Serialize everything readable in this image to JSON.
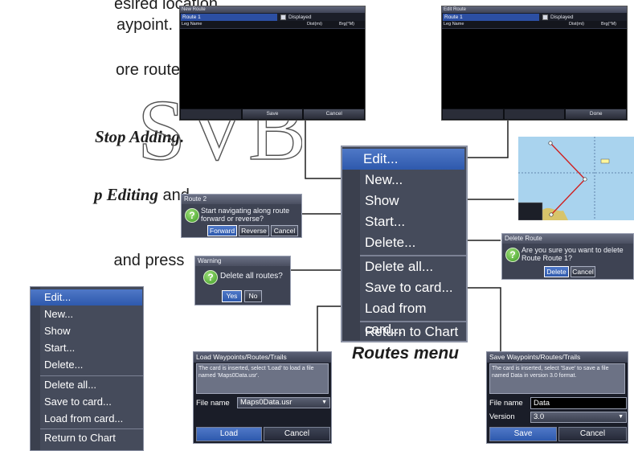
{
  "body_text": {
    "line1": "esired location.",
    "line2": "aypoint.",
    "line3": "ore route",
    "stop_adding": "Stop Adding.",
    "stop_editing": "p Editing",
    "and": " and",
    "and_press": " and press"
  },
  "watermark": "SVB",
  "new_route_screen": {
    "title": "New Route",
    "route_name": "Route 1",
    "displayed_label": "Displayed",
    "col_leg": "Leg Name",
    "col_dist": "Dist(mi)",
    "col_brg": "Brg(°M)",
    "save_label": "Save",
    "cancel_label": "Cancel"
  },
  "edit_route_screen": {
    "title": "Edit Route",
    "route_name": "Route 1",
    "displayed_label": "Displayed",
    "col_leg": "Leg Name",
    "col_dist": "Dist(mi)",
    "col_brg": "Brg(°M)",
    "done_label": "Done"
  },
  "routes_menu": {
    "caption": "Routes menu",
    "items": [
      "Edit...",
      "New...",
      "Show",
      "Start...",
      "Delete...",
      "Delete all...",
      "Save to card...",
      "Load from card...",
      "Return to Chart"
    ]
  },
  "small_menu": {
    "items": [
      "Edit...",
      "New...",
      "Show",
      "Start...",
      "Delete...",
      "Delete all...",
      "Save to card...",
      "Load from card...",
      "Return to Chart"
    ]
  },
  "start_dialog": {
    "title": "Route 2",
    "message": "Start navigating along route forward or reverse?",
    "forward_label": "Forward",
    "reverse_label": "Reverse",
    "cancel_label": "Cancel"
  },
  "warning_dialog": {
    "title": "Warning",
    "message": "Delete all routes?",
    "yes_label": "Yes",
    "no_label": "No"
  },
  "delete_dialog": {
    "title": "Delete Route",
    "message": "Are you sure you want to delete Route Route 1?",
    "delete_label": "Delete",
    "cancel_label": "Cancel"
  },
  "load_panel": {
    "title": "Load Waypoints/Routes/Trails",
    "description": "The card is inserted, select 'Load' to load a file named 'Maps0Data.usr'.",
    "file_label": "File name",
    "file_value": "Maps0Data.usr",
    "load_label": "Load",
    "cancel_label": "Cancel"
  },
  "save_panel": {
    "title": "Save Waypoints/Routes/Trails",
    "description": "The card is inserted, select 'Save' to save a file named Data in version 3.0 format.",
    "file_label": "File name",
    "file_value": "Data",
    "version_label": "Version",
    "version_value": "3.0",
    "save_label": "Save",
    "cancel_label": "Cancel"
  },
  "colors": {
    "highlight": "#2e59ad",
    "menu_bg": "#454b5b",
    "water": "#a9d3ee",
    "land": "#d8c46a",
    "route_line": "#d02020"
  }
}
